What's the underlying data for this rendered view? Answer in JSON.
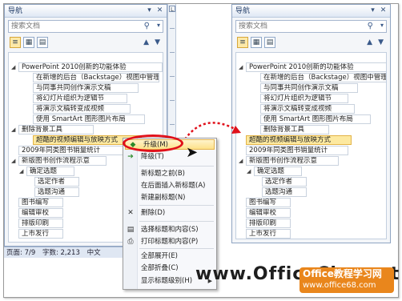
{
  "left_pane": {
    "title": "导航",
    "search_placeholder": "搜索文档",
    "items": [
      {
        "label": "PowerPoint 2010创新的功能体验",
        "expanded": true
      },
      {
        "label": "在新增的后台（Backstage）视图中管理..."
      },
      {
        "label": "与同事共同创作演示文稿"
      },
      {
        "label": "将幻灯片组织为逻辑节"
      },
      {
        "label": "将演示文稿转变成视频"
      },
      {
        "label": "使用 SmartArt 图形图片布局"
      },
      {
        "label": "删除背景工具",
        "expanded": true
      },
      {
        "label": "超酷的视频编辑与放映方式",
        "selected": true
      },
      {
        "label": "2009年同类图书销量统计"
      },
      {
        "label": "新版图书创作流程示意",
        "expanded": true
      },
      {
        "label": "确定选题",
        "expanded": true
      },
      {
        "label": "选定作者"
      },
      {
        "label": "选题沟通"
      },
      {
        "label": "图书编写"
      },
      {
        "label": "编辑审校"
      },
      {
        "label": "排版印刷"
      },
      {
        "label": "上市发行"
      }
    ]
  },
  "right_pane": {
    "title": "导航",
    "search_placeholder": "搜索文档",
    "items": [
      {
        "label": "PowerPoint 2010创新的功能体验",
        "expanded": true
      },
      {
        "label": "在新增的后台（Backstage）视图中管理..."
      },
      {
        "label": "与同事共同创作演示文稿"
      },
      {
        "label": "将幻灯片组织为逻辑节"
      },
      {
        "label": "将演示文稿转变成视频"
      },
      {
        "label": "使用 SmartArt 图形图片布局"
      },
      {
        "label": "删除背景工具"
      },
      {
        "label": "超酷的视频编辑与放映方式",
        "selected": true
      },
      {
        "label": "2009年同类图书销量统计"
      },
      {
        "label": "新版图书创作流程示意",
        "expanded": true
      },
      {
        "label": "确定选题",
        "expanded": true
      },
      {
        "label": "选定作者"
      },
      {
        "label": "选题沟通"
      },
      {
        "label": "图书编写"
      },
      {
        "label": "编辑审校"
      },
      {
        "label": "排版印刷"
      },
      {
        "label": "上市发行"
      }
    ]
  },
  "statusbar": {
    "page": "页面: 7/9",
    "words": "字数: 2,213",
    "lang": "中文"
  },
  "context_menu": {
    "items": [
      {
        "label": "升级(M)",
        "icon": "promote-arrow-icon",
        "glyph": "◆"
      },
      {
        "label": "降级(T)",
        "icon": "demote-arrow-icon",
        "glyph": "➔"
      },
      {
        "label": "新标题之前(B)",
        "icon": "",
        "glyph": ""
      },
      {
        "label": "在后面插入新标题(A)",
        "icon": "",
        "glyph": ""
      },
      {
        "label": "新建副标题(N)",
        "icon": "",
        "glyph": ""
      },
      {
        "label": "删除(D)",
        "icon": "delete-x-icon",
        "glyph": "✕"
      },
      {
        "label": "选择标题和内容(S)",
        "icon": "select-heading-icon",
        "glyph": "▤"
      },
      {
        "label": "打印标题和内容(P)",
        "icon": "print-icon",
        "glyph": "⎙"
      },
      {
        "label": "全部展开(E)",
        "icon": "",
        "glyph": ""
      },
      {
        "label": "全部折叠(C)",
        "icon": "",
        "glyph": ""
      },
      {
        "label": "显示标题级别(H)",
        "icon": "",
        "glyph": "",
        "submenu": true
      }
    ]
  },
  "watermark": {
    "text": "www.OfficeChu.net",
    "badge_line1": "Office教程学习网",
    "badge_line2": "www.office68.com"
  },
  "colors": {
    "selection": "#fde9a0",
    "highlight_ring": "#e0101a",
    "arrow": "#e0101a",
    "badge": "#e9861c"
  }
}
